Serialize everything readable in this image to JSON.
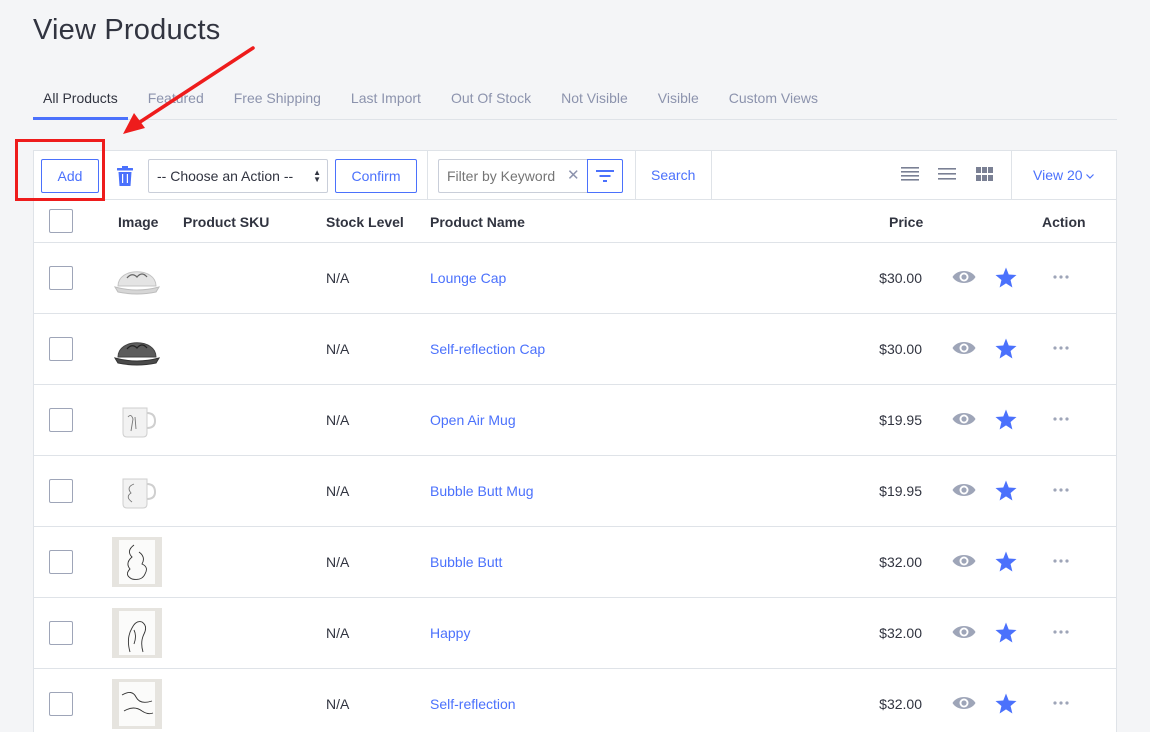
{
  "page": {
    "title": "View Products"
  },
  "tabs": [
    {
      "label": "All Products",
      "active": true
    },
    {
      "label": "Featured"
    },
    {
      "label": "Free Shipping"
    },
    {
      "label": "Last Import"
    },
    {
      "label": "Out Of Stock"
    },
    {
      "label": "Not Visible"
    },
    {
      "label": "Visible"
    },
    {
      "label": "Custom Views"
    }
  ],
  "toolbar": {
    "add_label": "Add",
    "action_select": "-- Choose an Action --",
    "confirm_label": "Confirm",
    "filter_placeholder": "Filter by Keyword",
    "search_label": "Search",
    "view_count_label": "View 20",
    "icons": [
      "trash-icon",
      "filter-icon",
      "list-view-icon",
      "compact-list-icon",
      "grid-view-icon",
      "chevron-down-icon"
    ]
  },
  "table": {
    "headers": {
      "image": "Image",
      "sku": "Product SKU",
      "stock": "Stock Level",
      "name": "Product Name",
      "price": "Price",
      "action": "Action"
    },
    "rows": [
      {
        "sku": "",
        "stock": "N/A",
        "name": "Lounge Cap",
        "price": "$30.00",
        "thumb": "light-cap"
      },
      {
        "sku": "",
        "stock": "N/A",
        "name": "Self-reflection Cap",
        "price": "$30.00",
        "thumb": "dark-cap"
      },
      {
        "sku": "",
        "stock": "N/A",
        "name": "Open Air Mug",
        "price": "$19.95",
        "thumb": "mug"
      },
      {
        "sku": "",
        "stock": "N/A",
        "name": "Bubble Butt Mug",
        "price": "$19.95",
        "thumb": "mug"
      },
      {
        "sku": "",
        "stock": "N/A",
        "name": "Bubble Butt",
        "price": "$32.00",
        "thumb": "art-print"
      },
      {
        "sku": "",
        "stock": "N/A",
        "name": "Happy",
        "price": "$32.00",
        "thumb": "art-print"
      },
      {
        "sku": "",
        "stock": "N/A",
        "name": "Self-reflection",
        "price": "$32.00",
        "thumb": "art-print"
      }
    ]
  },
  "colors": {
    "accent": "#4b71fc",
    "annotation": "#ee1c1c",
    "muted_icon": "#9ea5b8"
  }
}
